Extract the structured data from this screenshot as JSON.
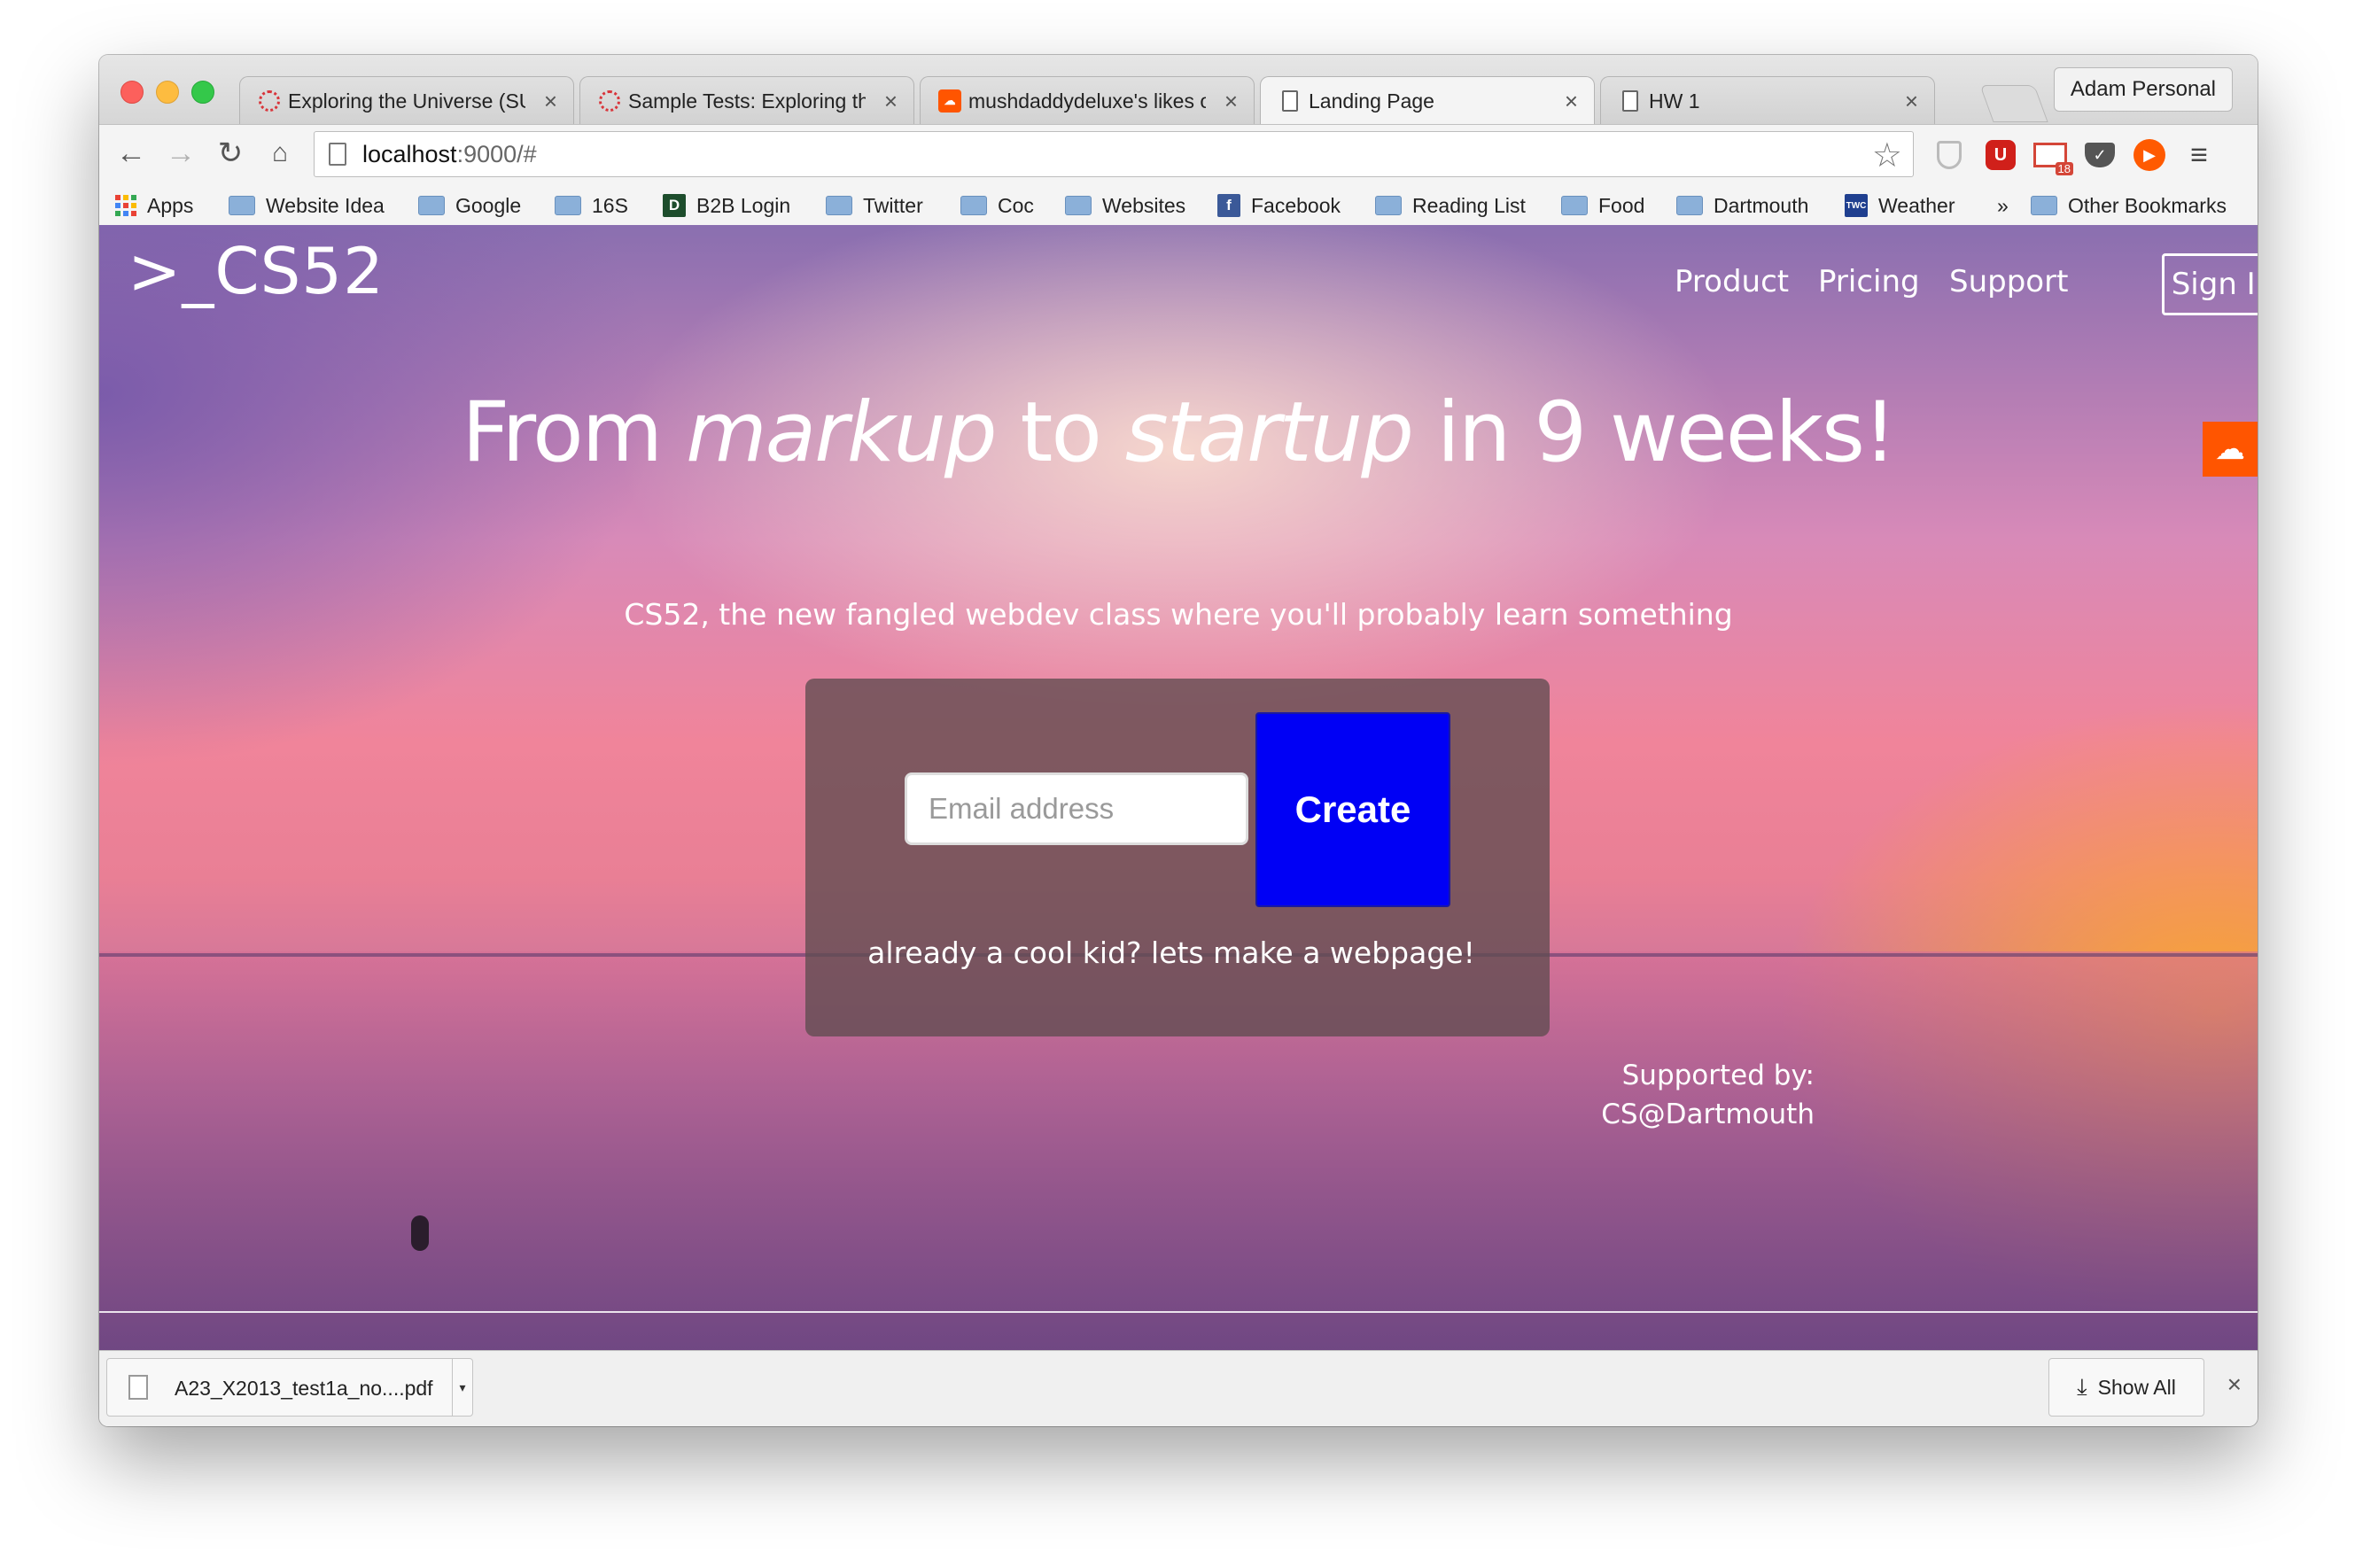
{
  "browser": {
    "tabs": [
      {
        "title": "Exploring the Universe (SU",
        "icon": "globe-red-icon",
        "active": false
      },
      {
        "title": "Sample Tests: Exploring the",
        "icon": "globe-red-icon",
        "active": false
      },
      {
        "title": "mushdaddydeluxe's likes o",
        "icon": "soundcloud-icon",
        "active": false
      },
      {
        "title": "Landing Page",
        "icon": "document-icon",
        "active": true
      },
      {
        "title": "HW 1",
        "icon": "document-icon",
        "active": false
      }
    ],
    "profile_name": "Adam Personal",
    "address": {
      "url_host": "localhost",
      "url_rest": ":9000/#"
    },
    "gmail_badge": "18",
    "bookmarks": [
      {
        "label": "Apps",
        "icon": "apps-grid-icon"
      },
      {
        "label": "Website Idea",
        "icon": "folder-icon"
      },
      {
        "label": "Google",
        "icon": "folder-icon"
      },
      {
        "label": "16S",
        "icon": "folder-icon"
      },
      {
        "label": "B2B Login",
        "icon": "b2b-icon"
      },
      {
        "label": "Twitter",
        "icon": "folder-icon"
      },
      {
        "label": "Coc",
        "icon": "folder-icon"
      },
      {
        "label": "Websites",
        "icon": "folder-icon"
      },
      {
        "label": "Facebook",
        "icon": "facebook-icon"
      },
      {
        "label": "Reading List",
        "icon": "folder-icon"
      },
      {
        "label": "Food",
        "icon": "folder-icon"
      },
      {
        "label": "Dartmouth",
        "icon": "folder-icon"
      },
      {
        "label": "Weather",
        "icon": "weather-channel-icon"
      },
      {
        "label": "»",
        "icon": "overflow-chevron-icon"
      },
      {
        "label": "Other Bookmarks",
        "icon": "folder-icon"
      }
    ]
  },
  "page": {
    "logo": ">_CS52",
    "nav": {
      "product": "Product",
      "pricing": "Pricing",
      "support": "Support",
      "sign_in": "Sign In"
    },
    "headline": {
      "part1": "From ",
      "em1": "markup",
      "part2": " to ",
      "em2": "startup",
      "part3": " in 9 weeks!"
    },
    "tagline": "CS52, the new fangled webdev class where you'll probably learn something",
    "signup": {
      "email_placeholder": "Email address",
      "email_value": "",
      "create_label": "Create",
      "cool_kid_text": "already a cool kid? lets make a webpage!"
    },
    "supported_by": {
      "label": "Supported by:",
      "org": "CS@Dartmouth"
    }
  },
  "download_shelf": {
    "file_name": "A23_X2013_test1a_no....pdf",
    "show_all": "Show All"
  },
  "colors": {
    "create_button": "#0000f5",
    "soundcloud": "#ff5500",
    "close_red": "#fc605c",
    "minimize_yellow": "#fdbc40",
    "zoom_green": "#34c84a"
  }
}
